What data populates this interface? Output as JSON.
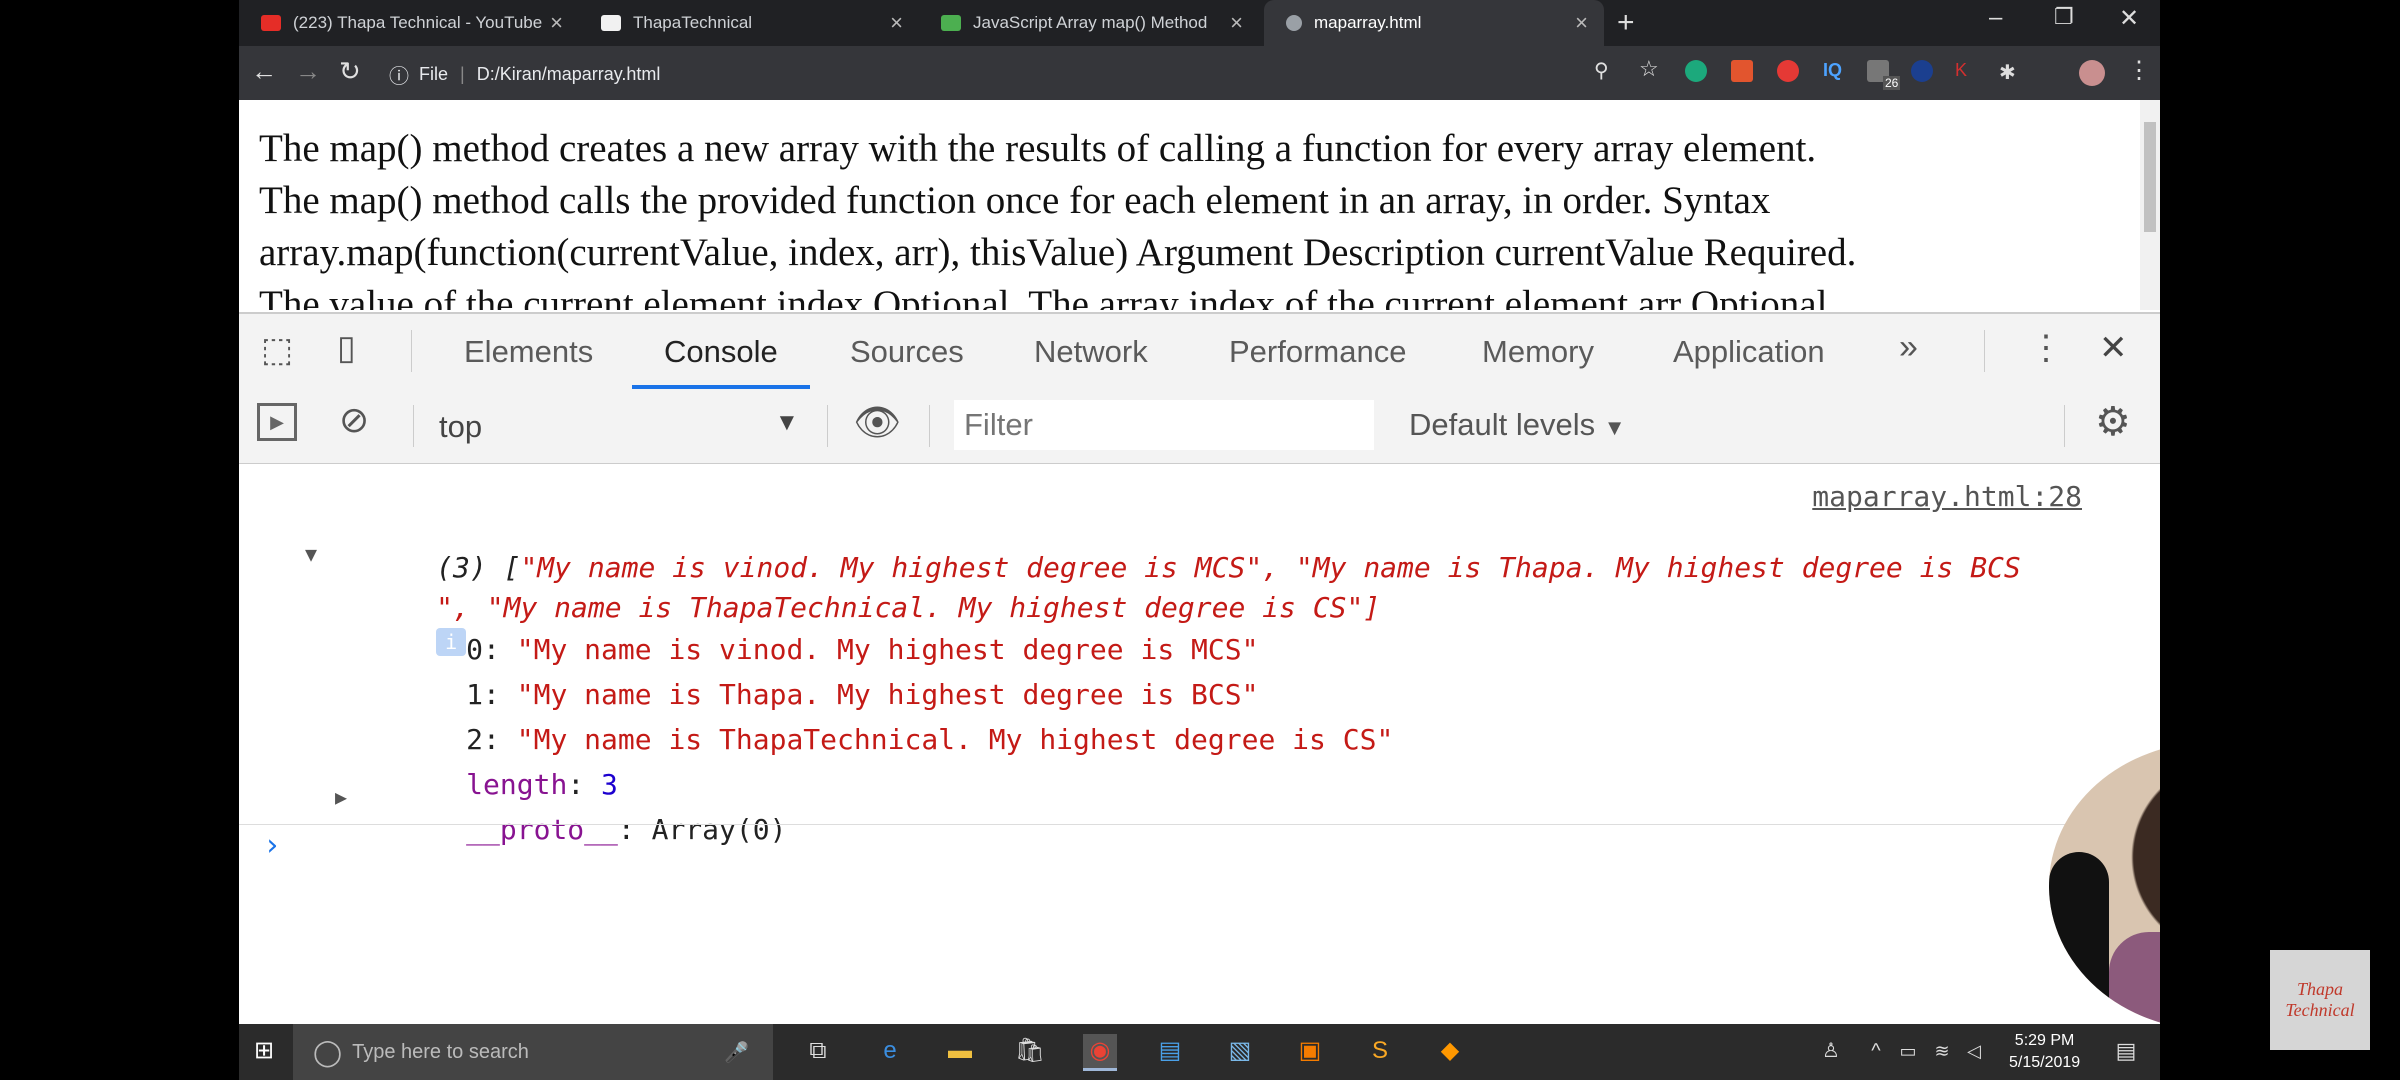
{
  "browser": {
    "tabs": [
      {
        "label": "(223) Thapa Technical - YouTube",
        "favicon_color": "#e52d27"
      },
      {
        "label": "ThapaTechnical",
        "favicon_color": "#f1f1f1"
      },
      {
        "label": "JavaScript Array map() Method",
        "favicon_color": "#4caf50"
      },
      {
        "label": "maparray.html",
        "favicon_color": "#9aa0a6"
      }
    ],
    "url_scheme": "File",
    "url": "D:/Kiran/maparray.html",
    "badge_count": "26"
  },
  "page": {
    "lines": [
      "The map() method creates a new array with the results of calling a function for every array element.",
      "The map() method calls the provided function once for each element in an array, in order. Syntax",
      "array.map(function(currentValue, index, arr), thisValue) Argument Description currentValue Required.",
      "The value of the current element index Optional. The array index of the current element arr Optional."
    ]
  },
  "devtools": {
    "tabs": [
      "Elements",
      "Console",
      "Sources",
      "Network",
      "Performance",
      "Memory",
      "Application"
    ],
    "more": "»",
    "context": "top",
    "filter_placeholder": "Filter",
    "levels": "Default levels"
  },
  "console": {
    "source": "maparray.html:28",
    "summary_prefix": "(3) [",
    "summary_line1": "\"My name is vinod. My highest degree is MCS\", \"My name is Thapa. My highest degree is BCS",
    "summary_line2": "\", \"My name is ThapaTechnical. My highest degree is CS\"]",
    "info_badge": "i",
    "items": [
      {
        "index": "0",
        "value": "\"My name is vinod. My highest degree is MCS\""
      },
      {
        "index": "1",
        "value": "\"My name is Thapa. My highest degree is BCS\""
      },
      {
        "index": "2",
        "value": "\"My name is ThapaTechnical. My highest degree is CS\""
      }
    ],
    "length_key": "length",
    "length_value": "3",
    "proto_key": "__proto__",
    "proto_value": "Array(0)",
    "prompt": "›"
  },
  "taskbar": {
    "search_placeholder": "Type here to search",
    "time": "5:29 PM",
    "date": "5/15/2019"
  },
  "watermark": "Thapa Technical"
}
